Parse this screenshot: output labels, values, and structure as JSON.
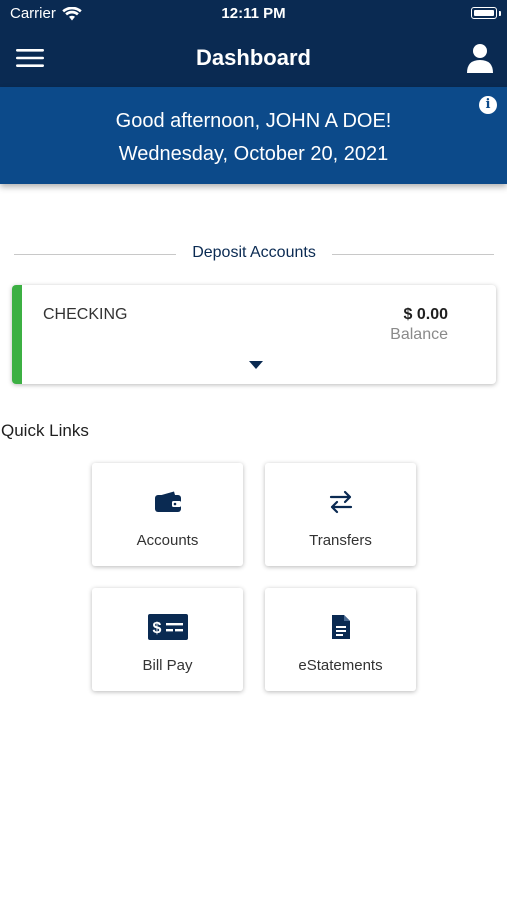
{
  "status_bar": {
    "carrier": "Carrier",
    "time": "12:11 PM"
  },
  "nav": {
    "title": "Dashboard",
    "menu_icon": "hamburger-menu-icon",
    "profile_icon": "user-profile-icon"
  },
  "greeting": {
    "line1": "Good afternoon, JOHN A DOE!",
    "line2": "Wednesday, October 20, 2021"
  },
  "deposit_accounts": {
    "section_title": "Deposit Accounts",
    "accounts": [
      {
        "name": "CHECKING",
        "balance": "$ 0.00",
        "balance_label": "Balance",
        "accent_color": "#3cb043"
      }
    ]
  },
  "quick_links": {
    "title": "Quick Links",
    "items": [
      {
        "label": "Accounts",
        "icon": "wallet-icon"
      },
      {
        "label": "Transfers",
        "icon": "transfer-arrows-icon"
      },
      {
        "label": "Bill Pay",
        "icon": "bill-pay-icon"
      },
      {
        "label": "eStatements",
        "icon": "document-icon"
      }
    ]
  },
  "colors": {
    "navy": "#0a2a52",
    "banner_blue": "#0c4a8a",
    "accent_green": "#3cb043"
  }
}
